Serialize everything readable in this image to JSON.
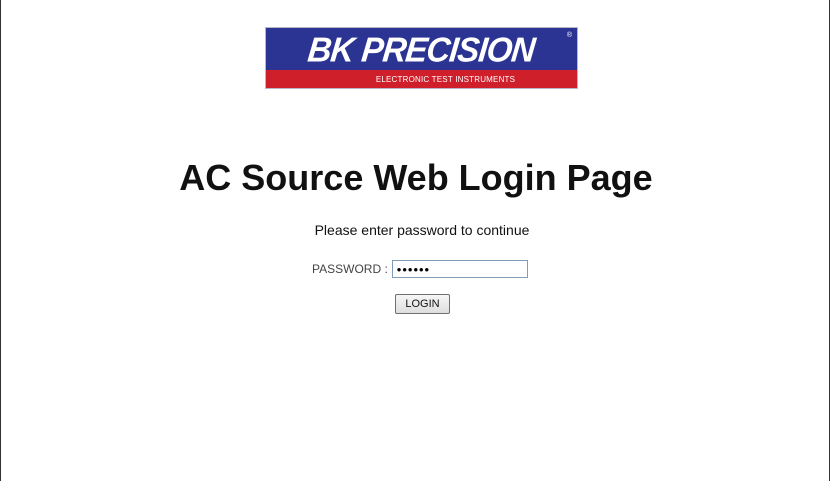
{
  "brand": {
    "wordmark": "BK PRECISION",
    "registered_mark": "®",
    "tagline": "ELECTRONIC TEST INSTRUMENTS",
    "colors": {
      "top_band": "#2c3493",
      "bottom_band": "#cf1f2b"
    }
  },
  "page": {
    "title": "AC Source Web Login Page",
    "instructions": "Please enter password to continue"
  },
  "form": {
    "password_label": "PASSWORD :",
    "password_value": "••••••",
    "login_label": "LOGIN"
  }
}
